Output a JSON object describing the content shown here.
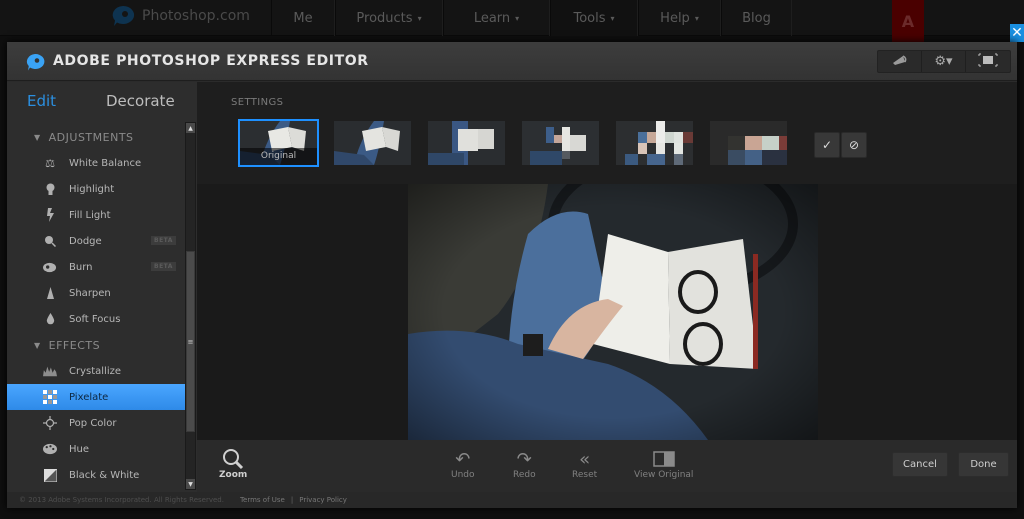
{
  "site_nav": {
    "logo_text": "Photoshop.com",
    "items": [
      {
        "label": "Me",
        "has_caret": false
      },
      {
        "label": "Products",
        "has_caret": true
      },
      {
        "label": "Learn",
        "has_caret": true
      },
      {
        "label": "Tools",
        "has_caret": true
      },
      {
        "label": "Help",
        "has_caret": true
      },
      {
        "label": "Blog",
        "has_caret": false
      }
    ],
    "caret": "▾",
    "adobe_badge": "A",
    "close_glyph": "✕"
  },
  "editor": {
    "title": "ADOBE PHOTOSHOP EXPRESS EDITOR",
    "toolbar_icons": [
      "megaphone-icon",
      "gear-icon",
      "fullscreen-icon"
    ],
    "toolbar_glyphs": [
      "📢",
      "⚙▾",
      "▣"
    ],
    "tabs": {
      "edit": "Edit",
      "decorate": "Decorate"
    },
    "sections": [
      {
        "label": "ADJUSTMENTS",
        "items": [
          {
            "label": "White Balance",
            "icon": "scale-icon",
            "glyph": "⚖",
            "beta": false
          },
          {
            "label": "Highlight",
            "icon": "lightbulb-icon",
            "glyph": "💡",
            "beta": false
          },
          {
            "label": "Fill Light",
            "icon": "lightning-icon",
            "glyph": "ϟ",
            "beta": false
          },
          {
            "label": "Dodge",
            "icon": "dodge-icon",
            "glyph": "⚲",
            "beta": true
          },
          {
            "label": "Burn",
            "icon": "burn-icon",
            "glyph": "◕",
            "beta": true
          },
          {
            "label": "Sharpen",
            "icon": "sharpen-icon",
            "glyph": "▲",
            "beta": false
          },
          {
            "label": "Soft Focus",
            "icon": "drop-icon",
            "glyph": "💧",
            "beta": false
          }
        ]
      },
      {
        "label": "EFFECTS",
        "items": [
          {
            "label": "Crystallize",
            "icon": "crystallize-icon",
            "glyph": "♛",
            "beta": false
          },
          {
            "label": "Pixelate",
            "icon": "pixelate-icon",
            "glyph": "▦",
            "beta": false,
            "active": true
          },
          {
            "label": "Pop Color",
            "icon": "crosshair-icon",
            "glyph": "⌖",
            "beta": false
          },
          {
            "label": "Hue",
            "icon": "palette-icon",
            "glyph": "🎨",
            "beta": false
          },
          {
            "label": "Black & White",
            "icon": "black-white-icon",
            "glyph": "◩",
            "beta": false
          }
        ]
      }
    ],
    "beta_label": "BETA",
    "section_caret": "▼",
    "scroll": {
      "up": "▲",
      "down": "▼",
      "grip": "≡"
    },
    "settings": {
      "label": "SETTINGS",
      "thumbnails": [
        {
          "caption": "Original",
          "selected": true,
          "pixel_level": 0
        },
        {
          "caption": "",
          "selected": false,
          "pixel_level": 1
        },
        {
          "caption": "",
          "selected": false,
          "pixel_level": 2
        },
        {
          "caption": "",
          "selected": false,
          "pixel_level": 3
        },
        {
          "caption": "",
          "selected": false,
          "pixel_level": 4
        },
        {
          "caption": "",
          "selected": false,
          "pixel_level": 5
        }
      ],
      "apply_glyph": "✓",
      "cancel_glyph": "⊘"
    },
    "bottom_tools": [
      {
        "label": "Zoom",
        "glyph": "⚲"
      },
      {
        "label": "Undo",
        "glyph": "↶"
      },
      {
        "label": "Redo",
        "glyph": "↷"
      },
      {
        "label": "Reset",
        "glyph": "«"
      },
      {
        "label": "View Original",
        "glyph": "◧"
      }
    ],
    "cancel_label": "Cancel",
    "done_label": "Done",
    "footer": {
      "copyright": "© 2013 Adobe Systems Incorporated. All Rights Reserved.",
      "terms": "Terms of Use",
      "separator": "|",
      "privacy": "Privacy Policy"
    }
  },
  "colors": {
    "accent": "#2b8fe0",
    "active_item": "#3a98f2",
    "selected_thumb_border": "#1e90ff"
  }
}
